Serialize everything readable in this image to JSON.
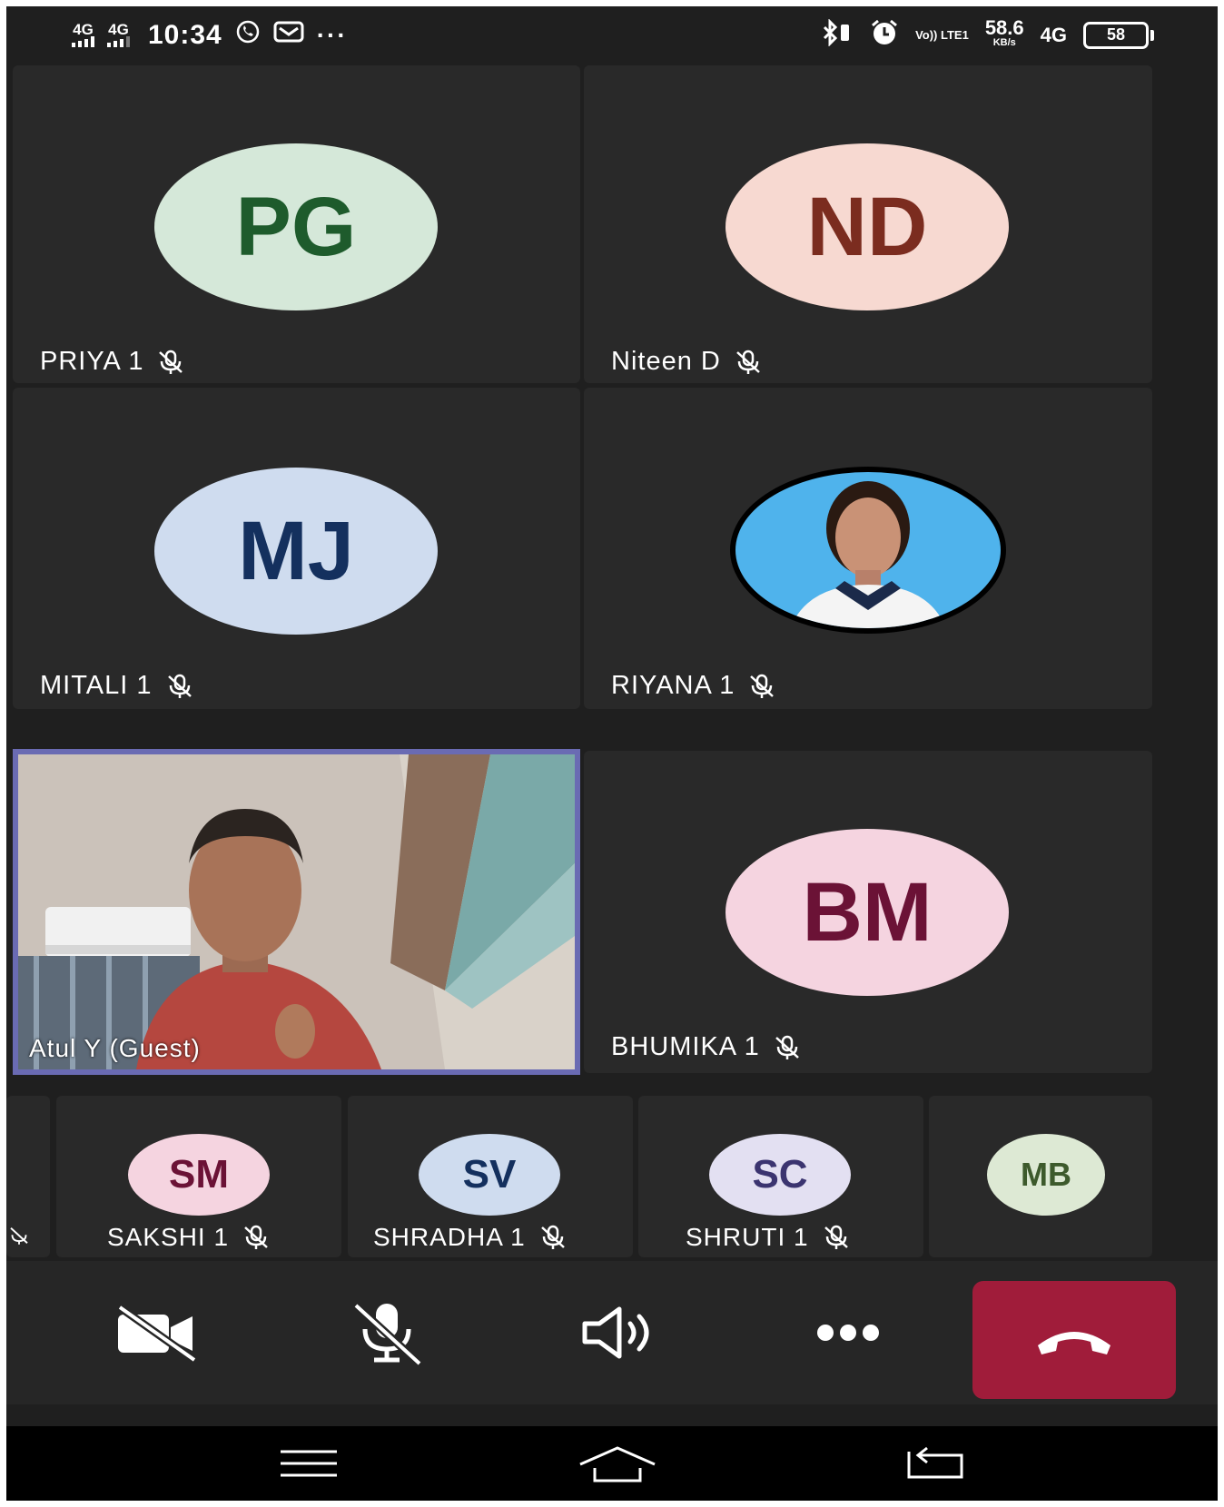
{
  "status_bar": {
    "network1": "4G",
    "network2": "4G",
    "time": "10:34",
    "speed_value": "58.6",
    "speed_unit": "KB/s",
    "volte": "Vo)) LTE1",
    "network3": "4G",
    "battery": "58"
  },
  "grid": [
    {
      "name": "PRIYA 1",
      "initials": "PG",
      "bg": "#d5e8d9",
      "fg": "#1e5b2c",
      "muted": true
    },
    {
      "name": "Niteen D",
      "initials": "ND",
      "bg": "#f7d9d1",
      "fg": "#7b2c1f",
      "muted": true
    },
    {
      "name": "MITALI 1",
      "initials": "MJ",
      "bg": "#cfdcef",
      "fg": "#14305e",
      "muted": true
    },
    {
      "name": "RIYANA 1",
      "initials": "",
      "bg": "#4fb3ec",
      "fg": "#000000",
      "muted": true
    },
    {
      "name": "Atul Y (Guest)",
      "initials": "",
      "muted": false
    },
    {
      "name": "BHUMIKA 1",
      "initials": "BM",
      "bg": "#f5d4e0",
      "fg": "#6b1236",
      "muted": true
    }
  ],
  "strip": [
    {
      "name": "SAKSHI 1",
      "initials": "SM",
      "bg": "#f5d4e0",
      "fg": "#6b1236",
      "muted": true
    },
    {
      "name": "SHRADHA 1",
      "initials": "SV",
      "bg": "#cfdcef",
      "fg": "#14305e",
      "muted": true
    },
    {
      "name": "SHRUTI 1",
      "initials": "SC",
      "bg": "#e3e0f2",
      "fg": "#3b3470",
      "muted": true
    },
    {
      "name": "",
      "initials": "MB",
      "bg": "#dde9d4",
      "fg": "#3d5a2c",
      "muted": false
    }
  ],
  "controls": {
    "camera": "camera-off",
    "mic": "mic-off",
    "speaker": "speaker",
    "more": "more",
    "hangup": "hang-up"
  },
  "colors": {
    "background": "#1f1f1f",
    "tile": "#292929",
    "hangup": "#a01c3a",
    "active_border": "#6a6bb3"
  }
}
